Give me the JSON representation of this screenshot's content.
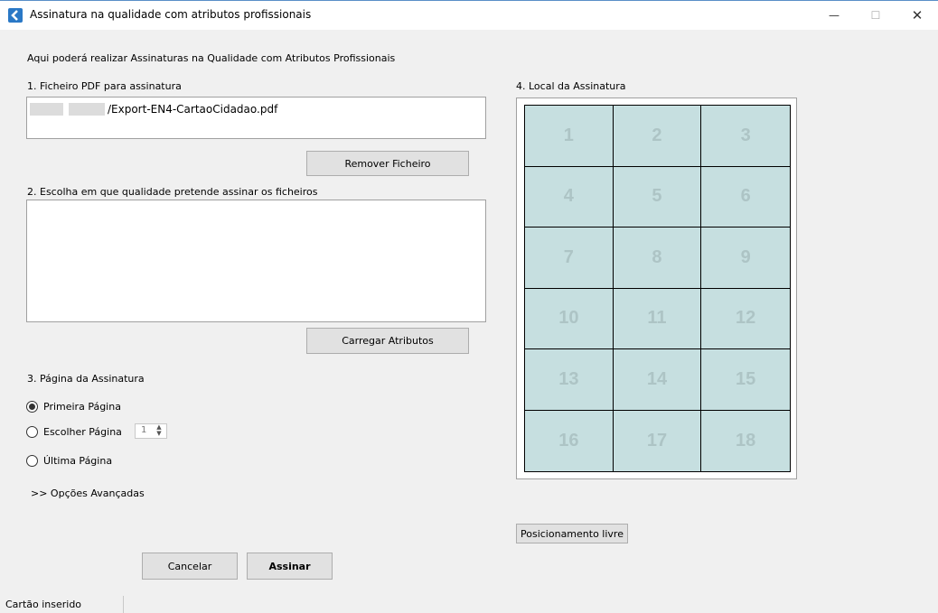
{
  "window": {
    "title": "Assinatura na qualidade com atributos profissionais",
    "minimize": "—",
    "maximize": "☐",
    "close": "✕"
  },
  "intro": "Aqui poderá realizar Assinaturas na Qualidade com Atributos Profissionais",
  "section1": {
    "label": "1. Ficheiro PDF para assinatura",
    "file_path": "/Export-EN4-CartaoCidadao.pdf",
    "remove_button": "Remover Ficheiro"
  },
  "section2": {
    "label": "2. Escolha em que qualidade pretende assinar os ficheiros",
    "load_button": "Carregar Atributos"
  },
  "section3": {
    "label": "3. Página da Assinatura",
    "options": [
      {
        "label": "Primeira Página",
        "checked": true
      },
      {
        "label": "Escolher Página",
        "checked": false
      },
      {
        "label": "Última Página",
        "checked": false
      }
    ],
    "page_number": "1",
    "advanced": ">> Opções Avançadas"
  },
  "section4": {
    "label": "4. Local da Assinatura",
    "cells": [
      "1",
      "2",
      "3",
      "4",
      "5",
      "6",
      "7",
      "8",
      "9",
      "10",
      "11",
      "12",
      "13",
      "14",
      "15",
      "16",
      "17",
      "18"
    ],
    "free_position_button": "Posicionamento livre"
  },
  "actions": {
    "cancel": "Cancelar",
    "sign": "Assinar"
  },
  "status": {
    "text": "Cartão inserido"
  },
  "colors": {
    "grid_fill": "#c6dfe0",
    "grid_number": "#adc4c5",
    "app_icon": "#2a78c6"
  }
}
